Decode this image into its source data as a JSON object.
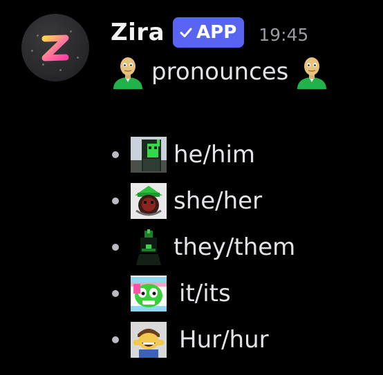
{
  "message": {
    "author": "Zira",
    "badge": {
      "label": "APP",
      "icon": "checkmark-icon",
      "color": "#5865f2"
    },
    "timestamp": "19:45",
    "title": "pronounces",
    "title_emoji": "baldi-emoji",
    "items": [
      {
        "label": "he/him",
        "icon": "he-him-emoji"
      },
      {
        "label": "she/her",
        "icon": "she-her-emoji"
      },
      {
        "label": "they/them",
        "icon": "they-them-emoji"
      },
      {
        "label": "it/its",
        "icon": "it-its-emoji"
      },
      {
        "label": "Hur/hur",
        "icon": "hur-hur-emoji"
      }
    ]
  },
  "colors": {
    "background": "#000000",
    "username": "#f2f3f5",
    "text": "#e3e4e7",
    "timestamp": "#9a9ba1"
  }
}
